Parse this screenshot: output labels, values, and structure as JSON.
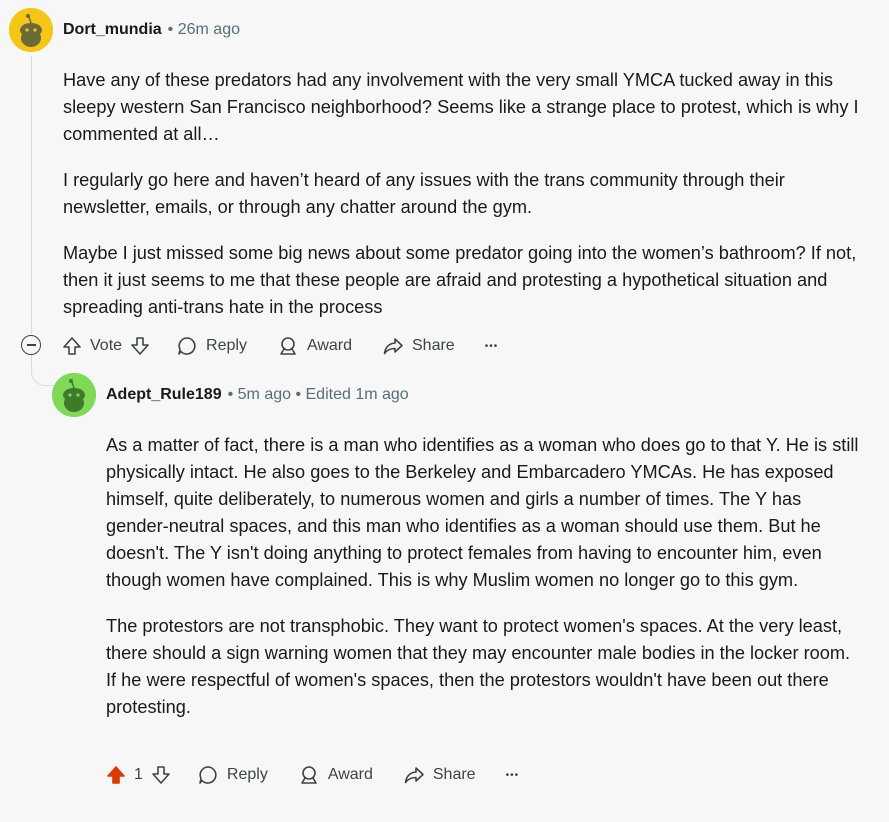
{
  "comments": [
    {
      "username": "Dort_mundia",
      "meta": "• 26m ago",
      "paragraphs": [
        "Have any of these predators had any involvement with the very small YMCA tucked away in this sleepy western San Francisco neighborhood? Seems like a strange place to protest, which is why I commented at all…",
        "I regularly go here and haven’t heard of any issues with the trans community through their newsletter, emails, or through any chatter around the gym.",
        "Maybe I just missed some big news about some predator going into the women’s bathroom? If not, then it just seems to me that these people are afraid and protesting a hypothetical situation and spreading anti-trans hate in the process"
      ],
      "vote_label": "Vote",
      "reply_label": "Reply",
      "award_label": "Award",
      "share_label": "Share",
      "avatar_color": "#f5c518"
    },
    {
      "username": "Adept_Rule189",
      "meta": "• 5m ago • Edited 1m ago",
      "paragraphs": [
        "As a matter of fact, there is a man who identifies as a woman who does go to that Y. He is still physically intact. He also goes to the Berkeley and Embarcadero YMCAs. He has exposed himself, quite deliberately, to numerous women and girls a number of times. The Y has gender-neutral spaces, and this man who identifies as a woman should use them. But he doesn't. The Y isn't doing anything to protect females from having to encounter him, even though women have complained. This is why Muslim women no longer go to this gym.",
        "The protestors are not transphobic. They want to protect women's spaces. At the very least, there should a sign warning women that they may encounter male bodies in the locker room. If he were respectful of women's spaces, then the protestors wouldn't have been out there protesting."
      ],
      "vote_count": "1",
      "reply_label": "Reply",
      "award_label": "Award",
      "share_label": "Share",
      "avatar_color": "#7ed957",
      "upvote_color": "#d93a00"
    }
  ],
  "more_label": "•••"
}
